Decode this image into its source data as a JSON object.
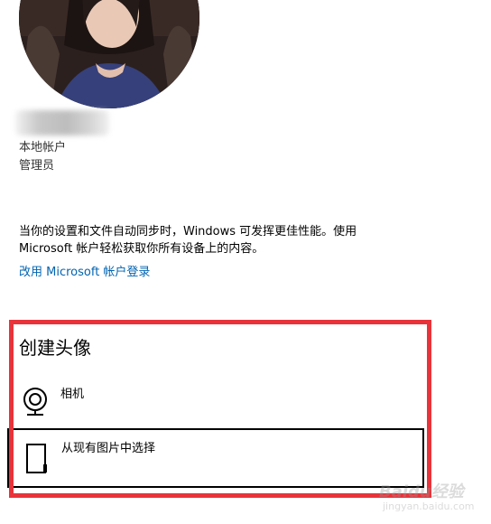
{
  "account": {
    "type": "本地帐户",
    "role": "管理员"
  },
  "sync": {
    "message": "当你的设置和文件自动同步时，Windows 可发挥更佳性能。使用 Microsoft 帐户轻松获取你所有设备上的内容。",
    "link_label": "改用 Microsoft 帐户登录"
  },
  "create_avatar": {
    "title": "创建头像",
    "options": [
      {
        "label": "相机",
        "icon": "webcam-icon"
      },
      {
        "label": "从现有图片中选择",
        "icon": "browse-picture-icon"
      }
    ]
  },
  "annotation": {
    "highlight_color": "#e8333a"
  },
  "colors": {
    "link": "#0063b1"
  },
  "watermark": {
    "logo": "Baidu经验",
    "url": "jingyan.baidu.com"
  }
}
